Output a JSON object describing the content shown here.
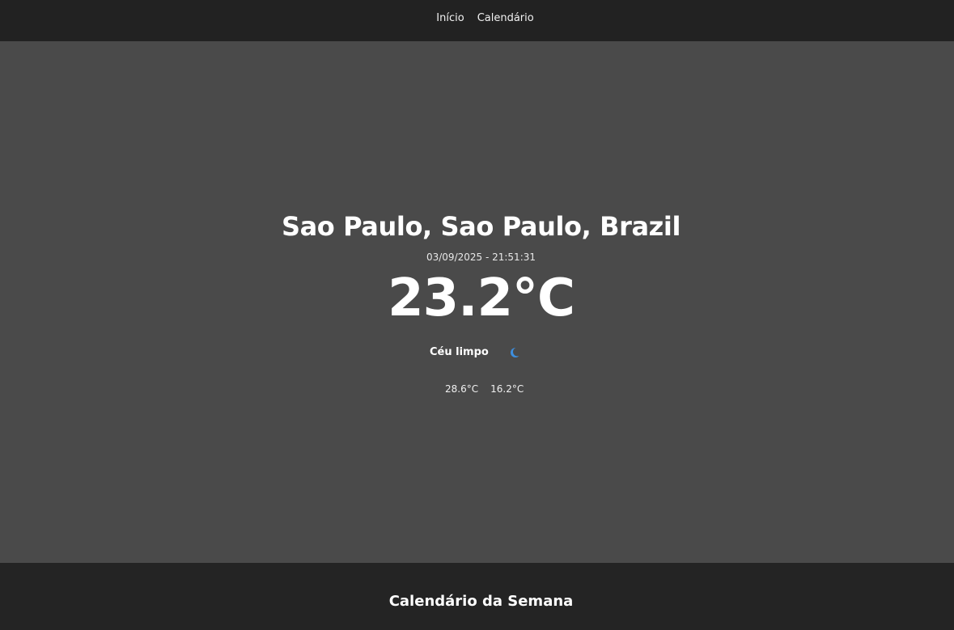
{
  "nav": {
    "items": [
      {
        "label": "Início"
      },
      {
        "label": "Calendário"
      }
    ]
  },
  "weather": {
    "location": "Sao Paulo, Sao Paulo, Brazil",
    "datetime": "03/09/2025 - 21:51:31",
    "temperature": "23.2°C",
    "condition": "Céu limpo",
    "condition_icon": "moon-icon",
    "max_temp": "28.6°C",
    "min_temp": "16.2°C"
  },
  "footer": {
    "title": "Calendário da Semana"
  },
  "colors": {
    "nav_background": "#222222",
    "main_background": "#4a4a4a",
    "footer_background": "#242424",
    "icon_accent": "#3d8fe0"
  }
}
